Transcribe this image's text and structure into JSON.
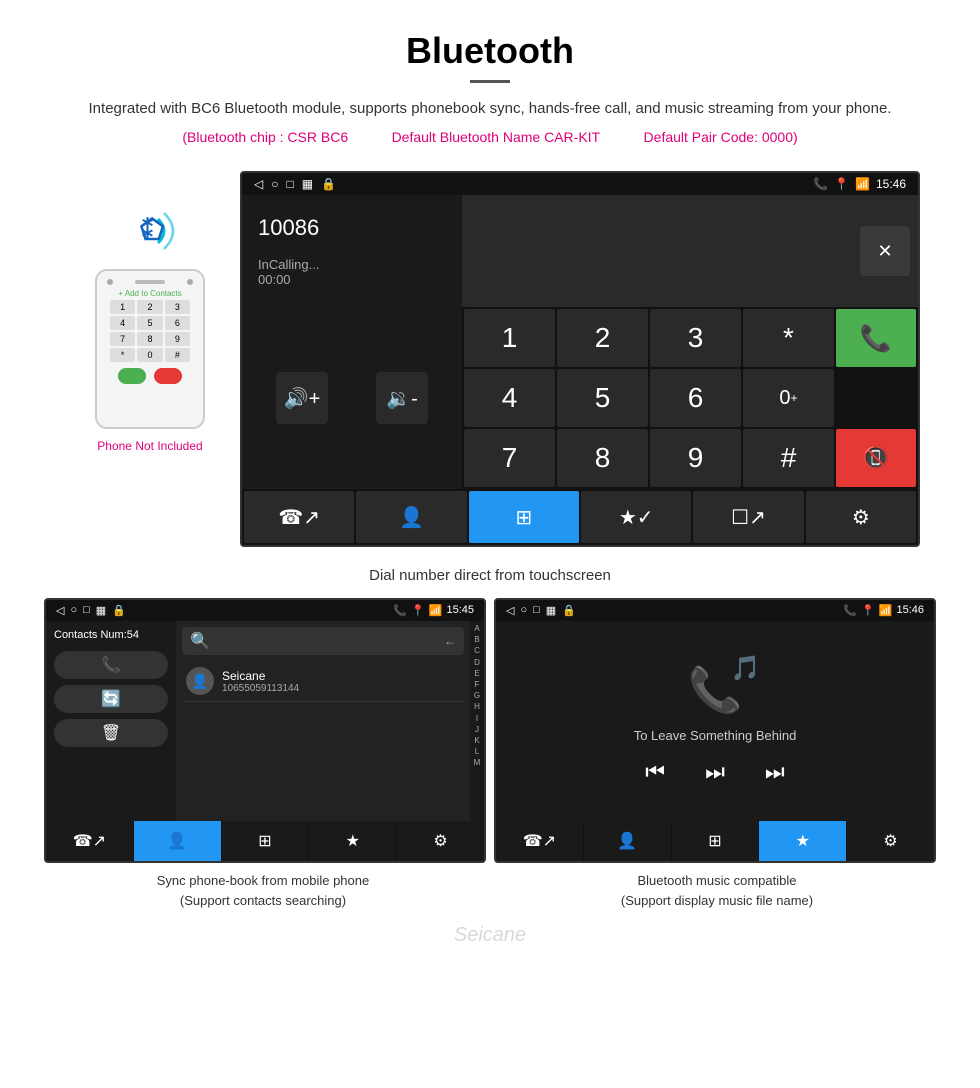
{
  "header": {
    "title": "Bluetooth",
    "description": "Integrated with BC6 Bluetooth module, supports phonebook sync, hands-free call, and music streaming from your phone.",
    "specs": {
      "chip": "(Bluetooth chip : CSR BC6",
      "name": "Default Bluetooth Name CAR-KIT",
      "code": "Default Pair Code: 0000)"
    }
  },
  "phone_mock": {
    "not_included": "Phone Not Included"
  },
  "dial_screen": {
    "status_bar": {
      "left": [
        "◁",
        "○",
        "□"
      ],
      "time": "15:46"
    },
    "number": "10086",
    "calling": "InCalling...",
    "timer": "00:00",
    "numpad": [
      "1",
      "2",
      "3",
      "*",
      "4",
      "5",
      "6",
      "0+",
      "7",
      "8",
      "9",
      "#"
    ],
    "caption": "Dial number direct from touchscreen"
  },
  "contacts_panel": {
    "status_bar_time": "15:45",
    "contacts_num": "Contacts Num:54",
    "search_placeholder": "",
    "contact": {
      "name": "Seicane",
      "number": "10655059113144"
    },
    "alpha": [
      "A",
      "B",
      "C",
      "D",
      "E",
      "F",
      "G",
      "H",
      "I",
      "J",
      "K",
      "L",
      "M"
    ],
    "caption_line1": "Sync phone-book from mobile phone",
    "caption_line2": "(Support contacts searching)"
  },
  "music_panel": {
    "status_bar_time": "15:46",
    "song_title": "To Leave Something Behind",
    "caption_line1": "Bluetooth music compatible",
    "caption_line2": "(Support display music file name)"
  },
  "watermark": "Seicane"
}
